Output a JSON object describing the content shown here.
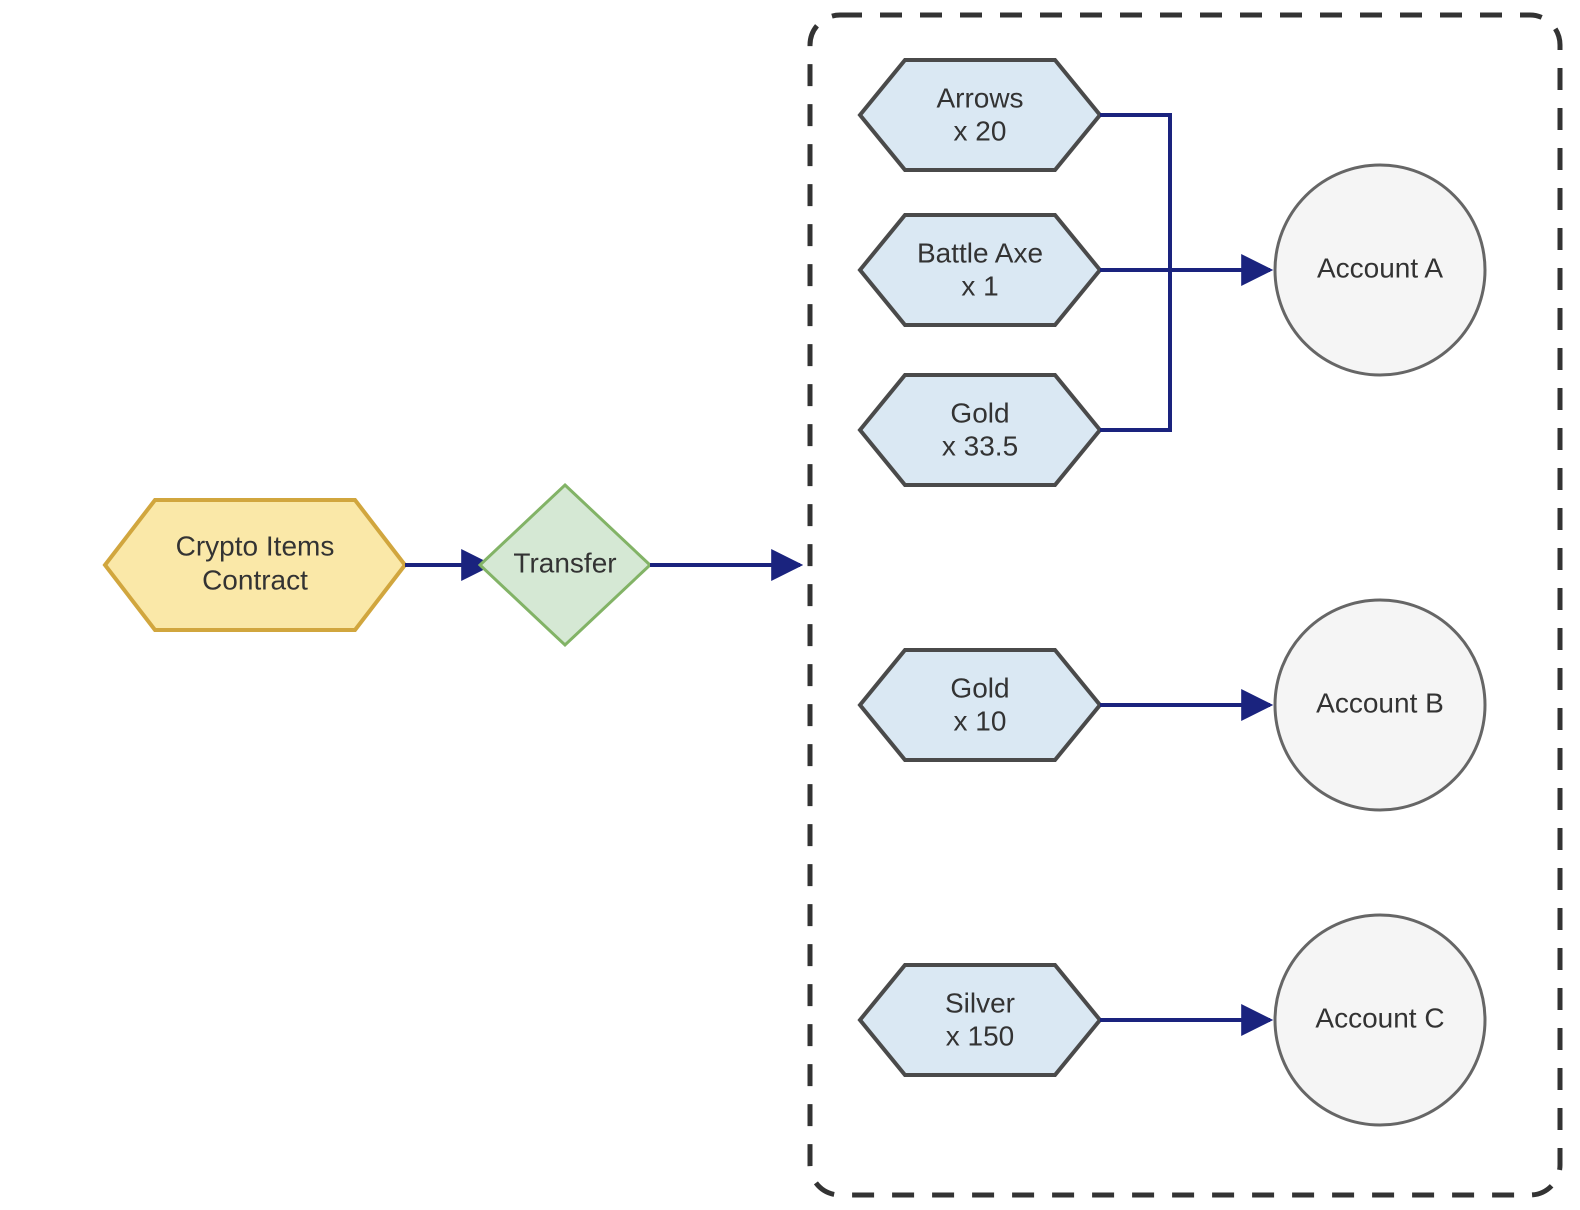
{
  "contract": {
    "label_line1": "Crypto Items",
    "label_line2": "Contract"
  },
  "transfer": {
    "label": "Transfer"
  },
  "items": {
    "arrows": {
      "name": "Arrows",
      "qty": "x 20"
    },
    "battleaxe": {
      "name": "Battle Axe",
      "qty": "x 1"
    },
    "gold_a": {
      "name": "Gold",
      "qty": "x 33.5"
    },
    "gold_b": {
      "name": "Gold",
      "qty": "x 10"
    },
    "silver": {
      "name": "Silver",
      "qty": "x 150"
    }
  },
  "accounts": {
    "a": {
      "label": "Account A"
    },
    "b": {
      "label": "Account B"
    },
    "c": {
      "label": "Account C"
    }
  },
  "colors": {
    "contract_fill": "#fae8a8",
    "contract_stroke": "#d1a63e",
    "transfer_fill": "#d5e8d4",
    "transfer_stroke": "#82b366",
    "item_fill": "#dae8f3",
    "item_stroke": "#4a4a4a",
    "account_fill": "#f5f5f5",
    "account_stroke": "#666666",
    "arrow": "#1a237e",
    "container_stroke": "#333333"
  }
}
